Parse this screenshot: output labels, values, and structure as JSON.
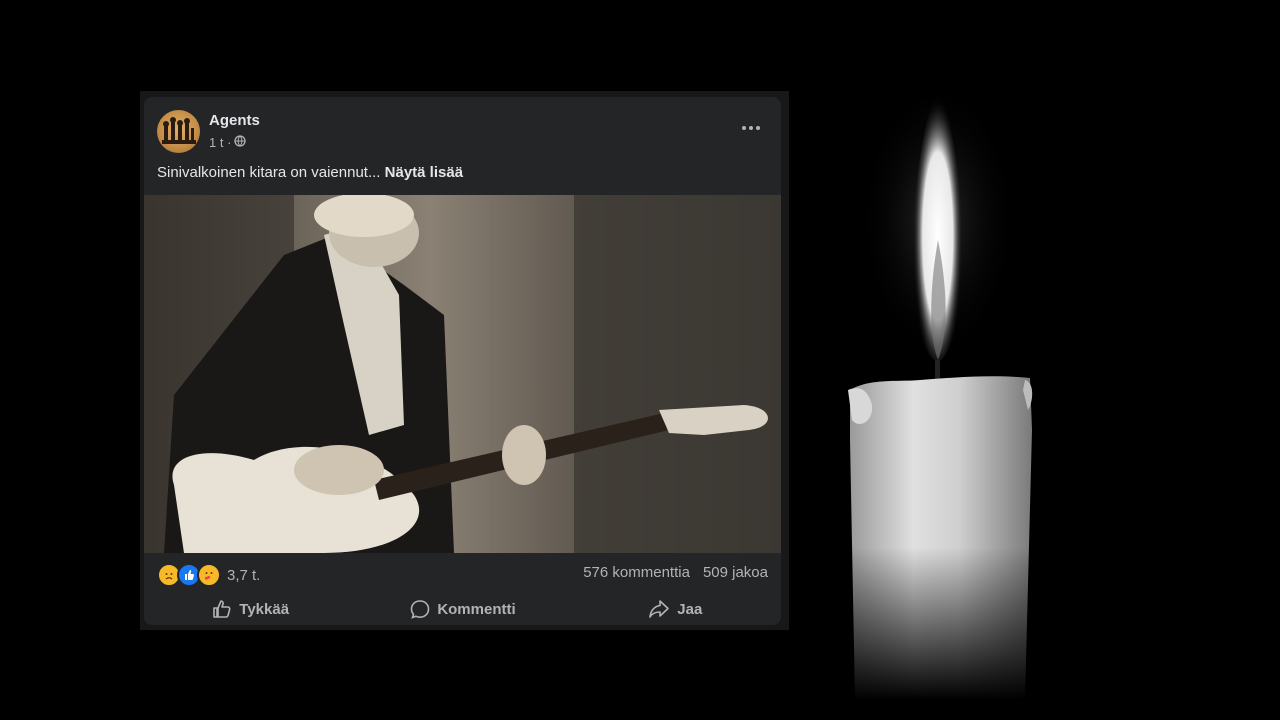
{
  "post": {
    "author": "Agents",
    "time": "1 t ·",
    "text": "Sinivalkoinen kitara on vaiennut...",
    "see_more": "Näytä lisää",
    "reactions": {
      "icons": [
        "sad-reaction-icon",
        "like-reaction-icon",
        "care-reaction-icon"
      ],
      "count": "3,7 t."
    },
    "comments": "576 kommenttia",
    "shares": "509 jakoa",
    "actions": {
      "like": "Tykkää",
      "comment": "Kommentti",
      "share": "Jaa"
    }
  },
  "colors": {
    "card_bg": "#242526",
    "text_primary": "#e4e6eb",
    "text_secondary": "#b0b3b8",
    "background": "#000000"
  }
}
